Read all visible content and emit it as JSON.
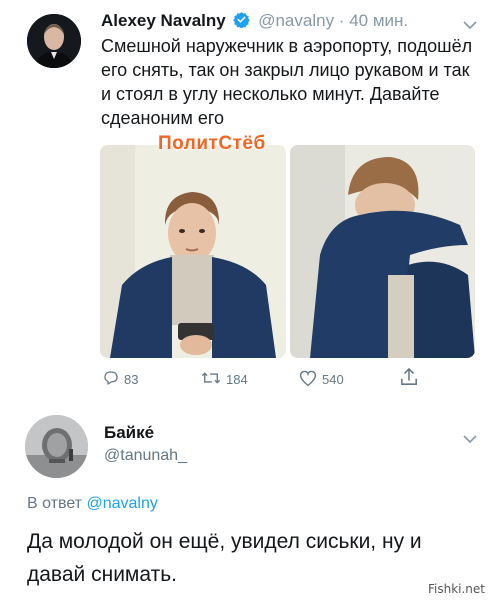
{
  "tweet": {
    "name": "Alexey Navalny",
    "handle": "@navalny",
    "separator": " · ",
    "time": "40 мин.",
    "text": "Смешной наружечник в аэропорту, подошёл его снять, так он закрыл лицо рукавом и так и стоял в углу несколько минут. Давайте сдеаноним его",
    "watermark": "ПолитСтёб",
    "actions": {
      "replies": "83",
      "retweets": "184",
      "likes": "540"
    },
    "verified_color": "#1da1f2"
  },
  "reply": {
    "name": "Байке́",
    "handle": "@tanunah_",
    "reply_prefix": "В ответ",
    "reply_to": "@navalny",
    "text": "Да молодой он ещё, увидел сиськи, ну и давай снимать."
  },
  "site_watermark": "Fishki.net",
  "colors": {
    "link": "#1da1f2",
    "secondary_text": "#657786",
    "watermark": "#f26522"
  }
}
